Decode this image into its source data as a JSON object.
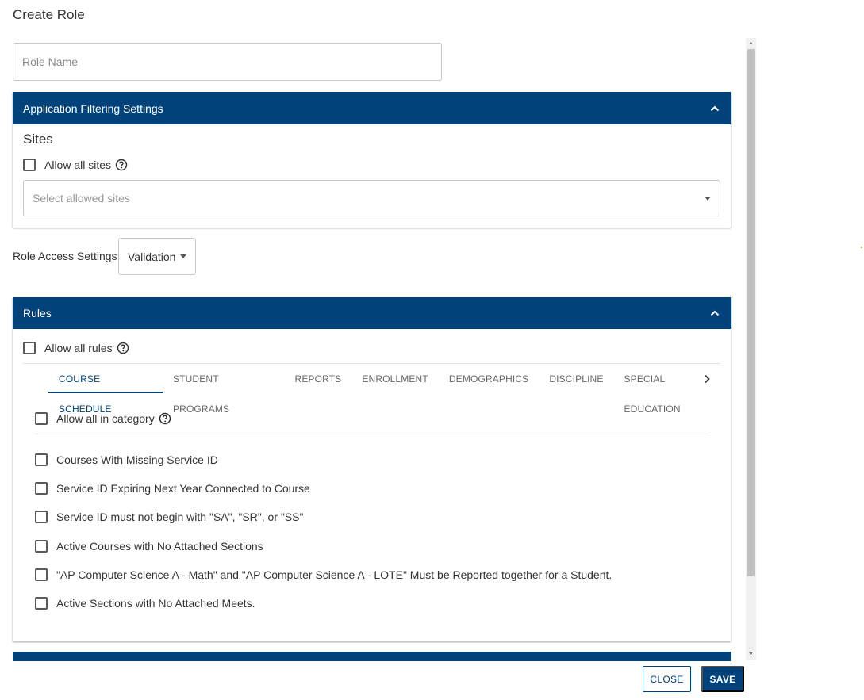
{
  "dialog": {
    "title": "Create Role"
  },
  "role_name": {
    "placeholder": "Role Name",
    "value": ""
  },
  "app_filtering": {
    "header": "Application Filtering Settings",
    "sites_title": "Sites",
    "allow_all_sites": "Allow all sites",
    "select_placeholder": "Select allowed sites"
  },
  "role_access": {
    "label": "Role Access Settings",
    "selected": "Validation"
  },
  "rules": {
    "header": "Rules",
    "allow_all": "Allow all rules",
    "tabs": [
      {
        "label": "COURSE SCHEDULE",
        "active": true
      },
      {
        "label": "STUDENT PROGRAMS"
      },
      {
        "label": "REPORTS"
      },
      {
        "label": "ENROLLMENT"
      },
      {
        "label": "DEMOGRAPHICS"
      },
      {
        "label": "DISCIPLINE"
      },
      {
        "label": "SPECIAL EDUCATION"
      }
    ],
    "allow_all_category": "Allow all in category",
    "items": [
      "Courses With Missing Service ID",
      "Service ID Expiring Next Year Connected to Course",
      "Service ID must not begin with \"SA\", \"SR\", or \"SS\"",
      "Active Courses with No Attached Sections",
      "\"AP Computer Science A - Math\" and \"AP Computer Science A - LOTE\" Must be Reported together for a Student.",
      "Active Sections with No Attached Meets."
    ]
  },
  "footer": {
    "close_label": "CLOSE",
    "save_label": "SAVE"
  },
  "colors": {
    "primary": "#02427a",
    "border": "#c8c8c8"
  }
}
